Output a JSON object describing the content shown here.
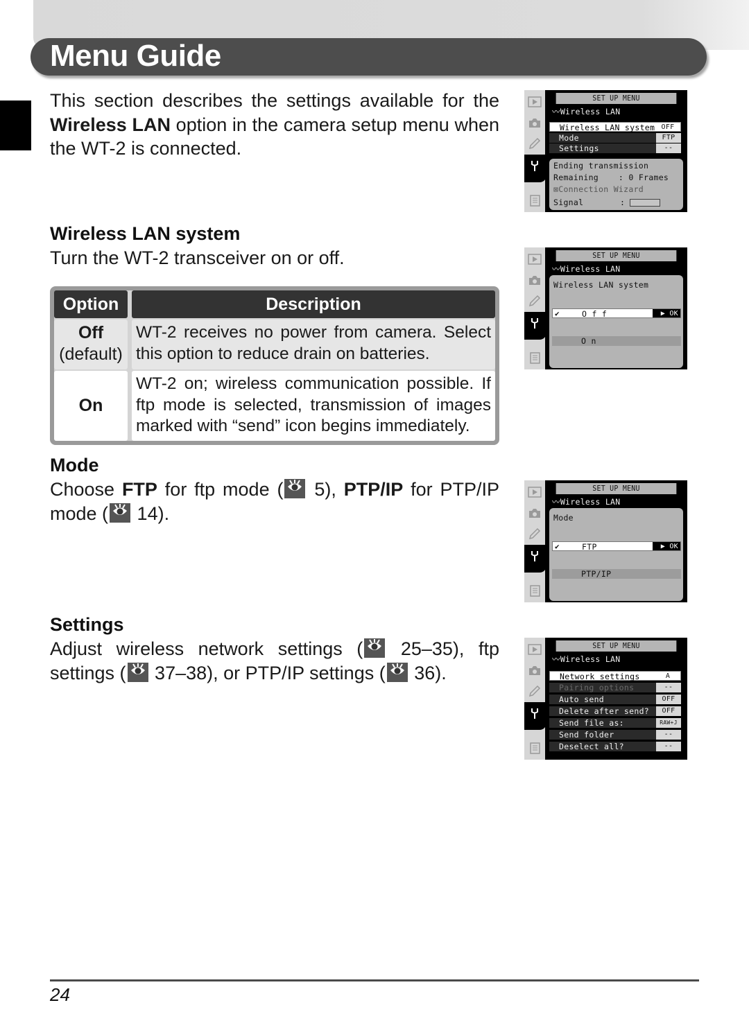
{
  "header": {
    "title": "Menu Guide"
  },
  "intro": {
    "text_before": "This section describes the settings available for the ",
    "bold": "Wireless LAN",
    "text_after": " option in the camera setup menu when the WT-2 is connected."
  },
  "sections": {
    "wireless_lan_system": {
      "heading": "Wireless LAN system",
      "text": "Turn the WT-2 transceiver on or off."
    },
    "mode": {
      "heading": "Mode",
      "t1": "Choose ",
      "b1": "FTP",
      "t2": " for ftp mode (",
      "ref1": " 5), ",
      "b2": "PTP/IP",
      "t3": " for PTP/IP mode (",
      "ref2": " 14)."
    },
    "settings": {
      "heading": "Settings",
      "t1": "Adjust wireless network settings (",
      "ref1": " 25–35), ftp settings (",
      "ref2": " 37–38), or PTP/IP settings (",
      "ref3": " 36)."
    }
  },
  "option_table": {
    "headers": [
      "Option",
      "Description"
    ],
    "rows": [
      {
        "option": "Off",
        "note": "(default)",
        "description": "WT-2 receives no power from camera.  Select this option to reduce drain on batteries."
      },
      {
        "option": "On",
        "note": "",
        "description": "WT-2 on; wireless communication possible.  If ftp mode is selected, transmission of images marked with “send” icon begins immediately."
      }
    ]
  },
  "camera_screens": {
    "menu_title": "SET UP MENU",
    "submenu": "Wireless LAN",
    "screen1": {
      "rows": [
        {
          "label": "Wireless LAN system",
          "value": "OFF"
        },
        {
          "label": "Mode",
          "value": "FTP"
        },
        {
          "label": "Settings",
          "value": "--"
        }
      ],
      "status": {
        "line1": "Ending transmission",
        "remaining_label": "Remaining",
        "remaining_value": ":   0 Frames",
        "wizard": "Connection Wizard",
        "signal_label": "Signal",
        "signal_sep": ":"
      }
    },
    "screen2": {
      "prompt": "Wireless LAN system",
      "options": [
        "O f f",
        "O n"
      ],
      "selected": "O f f",
      "ok": "▶ OK"
    },
    "screen3": {
      "prompt": "Mode",
      "options": [
        "FTP",
        "PTP/IP"
      ],
      "selected": "FTP",
      "ok": "▶ OK"
    },
    "screen4": {
      "rows": [
        {
          "label": "Network settings",
          "value": "A"
        },
        {
          "label": "Pairing options",
          "value": "--"
        },
        {
          "label": "Auto send",
          "value": "OFF"
        },
        {
          "label": "Delete after send?",
          "value": "OFF"
        },
        {
          "label": "Send file as:",
          "value": "RAW+J"
        },
        {
          "label": "Send folder",
          "value": "--"
        },
        {
          "label": "Deselect all?",
          "value": "--"
        }
      ]
    }
  },
  "footer": {
    "page_number": "24"
  }
}
